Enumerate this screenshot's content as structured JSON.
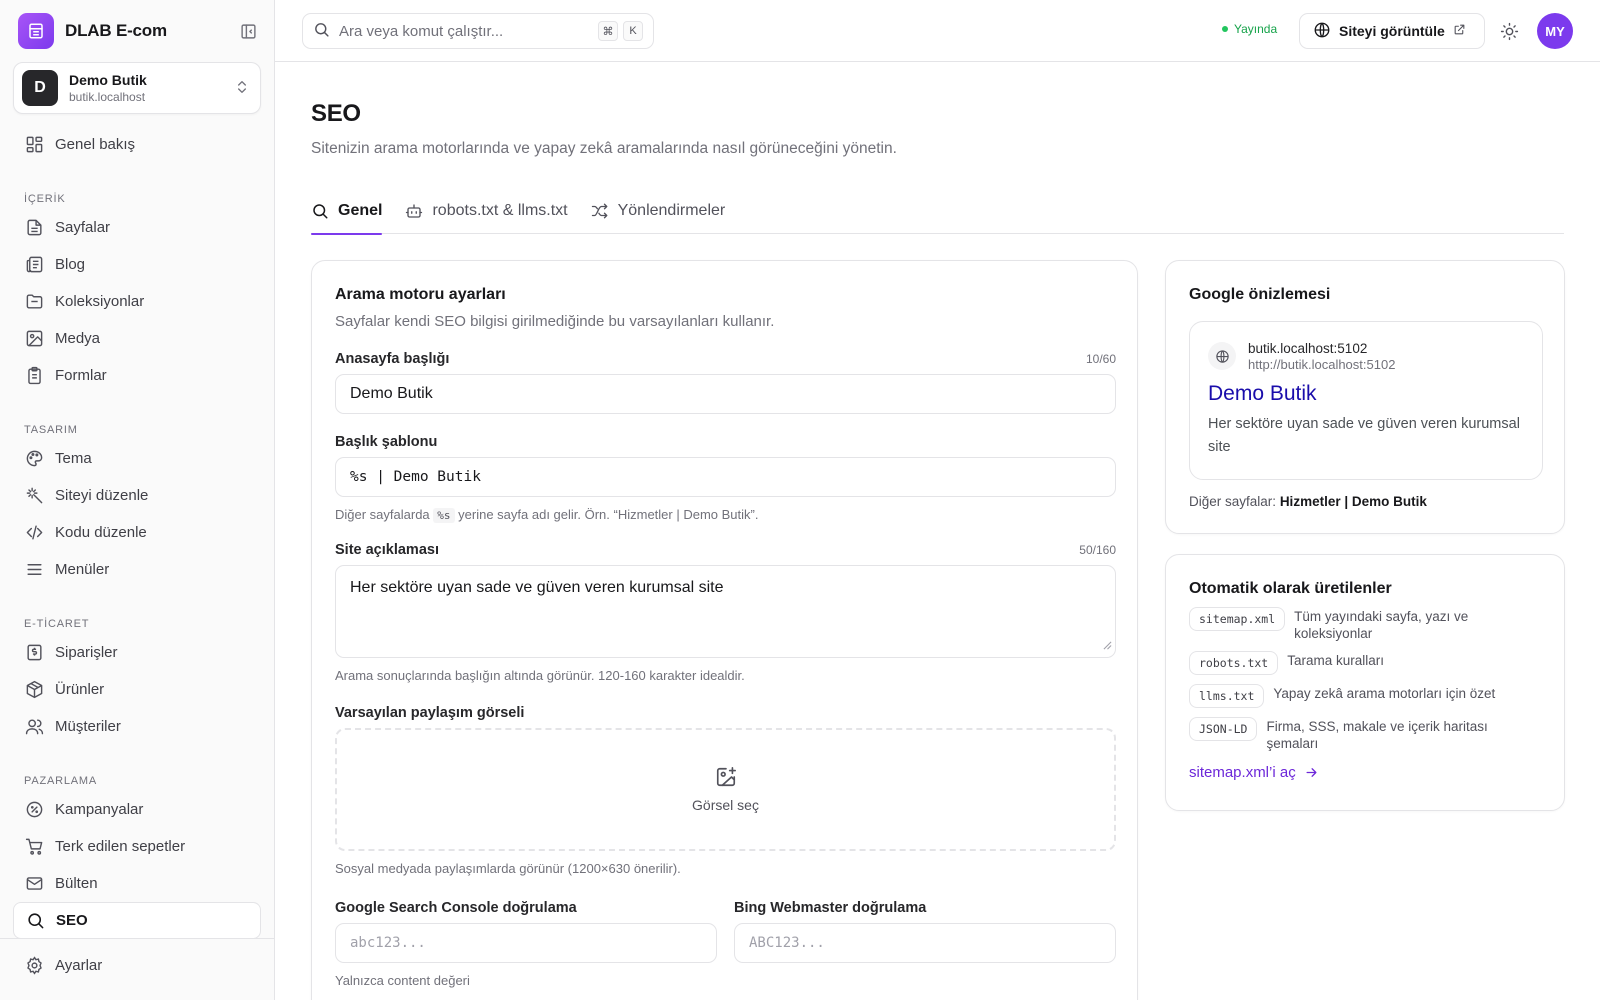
{
  "brand": {
    "name": "DLAB E-com"
  },
  "site": {
    "initial": "D",
    "name": "Demo Butik",
    "domain": "butik.localhost"
  },
  "nav": {
    "overview": "Genel bakış",
    "sections": {
      "content": "İÇERİK",
      "design": "TASARIM",
      "ecommerce": "E-TİCARET",
      "marketing": "PAZARLAMA"
    },
    "items": {
      "pages": "Sayfalar",
      "blog": "Blog",
      "collections": "Koleksiyonlar",
      "media": "Medya",
      "forms": "Formlar",
      "theme": "Tema",
      "edit_site": "Siteyi düzenle",
      "edit_code": "Kodu düzenle",
      "menus": "Menüler",
      "orders": "Siparişler",
      "products": "Ürünler",
      "customers": "Müşteriler",
      "campaigns": "Kampanyalar",
      "abandoned_carts": "Terk edilen sepetler",
      "newsletter": "Bülten",
      "seo": "SEO"
    },
    "settings": "Ayarlar"
  },
  "topbar": {
    "search_placeholder": "Ara veya komut çalıştır...",
    "shortcut_mod": "⌘",
    "shortcut_key": "K",
    "status": "Yayında",
    "view_site": "Siteyi görüntüle",
    "user_initials": "MY"
  },
  "page": {
    "title": "SEO",
    "subtitle": "Sitenizin arama motorlarında ve yapay zekâ aramalarında nasıl görüneceğini yönetin."
  },
  "tabs": {
    "general": "Genel",
    "robots": "robots.txt & llms.txt",
    "redirects": "Yönlendirmeler"
  },
  "search_settings": {
    "title": "Arama motoru ayarları",
    "description": "Sayfalar kendi SEO bilgisi girilmediğinde bu varsayılanları kullanır.",
    "home_title_label": "Anasayfa başlığı",
    "home_title_counter": "10/60",
    "home_title_value": "Demo Butik",
    "title_template_label": "Başlık şablonu",
    "title_template_value": "%s | Demo Butik",
    "title_template_help_before": "Diğer sayfalarda",
    "title_template_help_code": "%s",
    "title_template_help_after": "yerine sayfa adı gelir. Örn. “Hizmetler | Demo Butik”.",
    "description_label": "Site açıklaması",
    "description_counter": "50/160",
    "description_value": "Her sektöre uyan sade ve güven veren kurumsal site",
    "description_help": "Arama sonuçlarında başlığın altında görünür. 120-160 karakter idealdir.",
    "share_image_label": "Varsayılan paylaşım görseli",
    "share_image_button": "Görsel seç",
    "share_image_help": "Sosyal medyada paylaşımlarda görünür (1200×630 önerilir).",
    "gsc_label": "Google Search Console doğrulama",
    "gsc_placeholder": "abc123...",
    "bing_label": "Bing Webmaster doğrulama",
    "bing_placeholder": "ABC123...",
    "cut_help": "Yalnızca content değeri"
  },
  "google_preview": {
    "title": "Google önizlemesi",
    "domain": "butik.localhost:5102",
    "url": "http://butik.localhost:5102",
    "result_title": "Demo Butik",
    "result_description": "Her sektöre uyan sade ve güven veren kurumsal site",
    "others_label": "Diğer sayfalar:",
    "others_value": "Hizmetler | Demo Butik"
  },
  "auto_generated": {
    "title": "Otomatik olarak üretilenler",
    "items": [
      {
        "file": "sitemap.xml",
        "desc": "Tüm yayındaki sayfa, yazı ve koleksiyonlar"
      },
      {
        "file": "robots.txt",
        "desc": "Tarama kuralları"
      },
      {
        "file": "llms.txt",
        "desc": "Yapay zekâ arama motorları için özet"
      },
      {
        "file": "JSON-LD",
        "desc": "Firma, SSS, makale ve içerik haritası şemaları"
      }
    ],
    "link": "sitemap.xml’i aç"
  },
  "colors": {
    "accent": "#7c3aed",
    "status": "#22c55e",
    "google_link": "#1a0dab"
  }
}
